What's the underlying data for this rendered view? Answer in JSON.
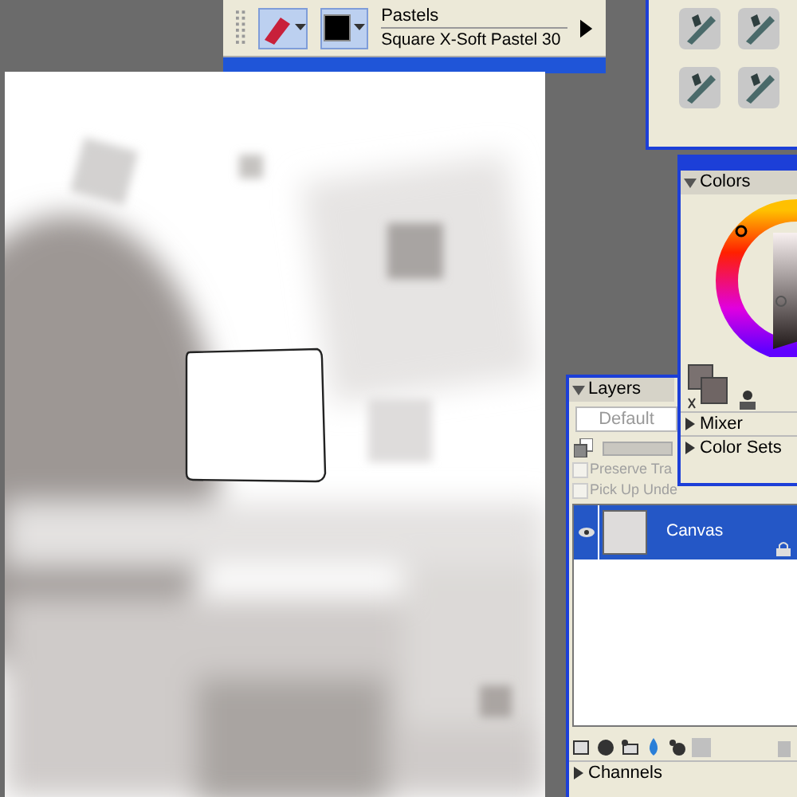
{
  "brush_bar": {
    "category": "Pastels",
    "variant": "Square X-Soft Pastel 30"
  },
  "colors_panel": {
    "title": "Colors",
    "expanded": true,
    "sections": [
      {
        "label": "Mixer",
        "expanded": false
      },
      {
        "label": "Color Sets",
        "expanded": false
      }
    ]
  },
  "layers_panel": {
    "title": "Layers",
    "expanded": true,
    "composite": "Default",
    "opacity": {
      "level": 1
    },
    "options": [
      {
        "label": "Preserve Tra",
        "checked": false,
        "disabled": true
      },
      {
        "label": "Pick Up Unde",
        "checked": false,
        "disabled": true
      }
    ],
    "layers": [
      {
        "name": "Canvas",
        "selected": true,
        "visible": true,
        "locked": true
      }
    ],
    "channels": {
      "label": "Channels",
      "expanded": false
    }
  }
}
